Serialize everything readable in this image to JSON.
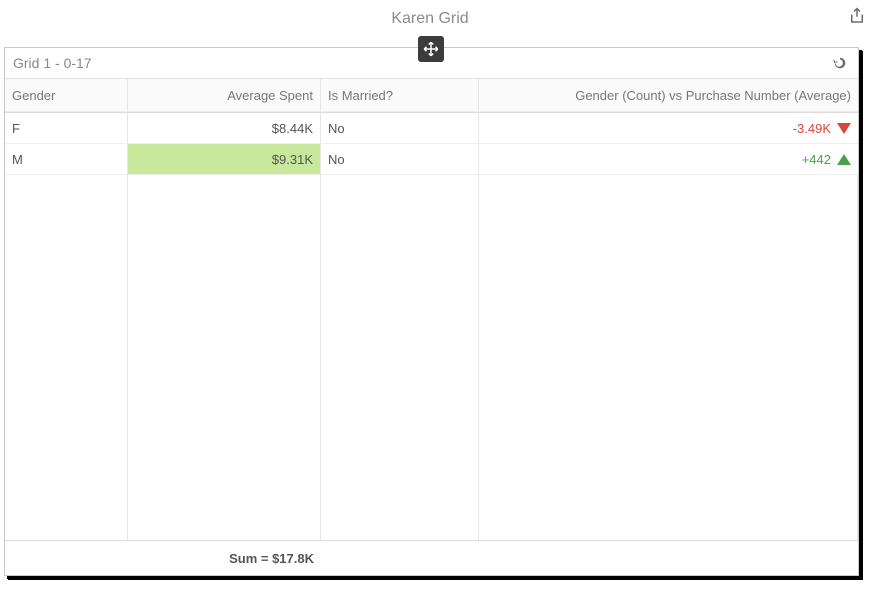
{
  "page": {
    "title": "Karen Grid"
  },
  "panel": {
    "title": "Grid 1 - 0-17"
  },
  "columns": {
    "c0": "Gender",
    "c1": "Average Spent",
    "c2": "Is Married?",
    "c3": "Gender (Count) vs Purchase Number (Average)"
  },
  "rows": [
    {
      "gender": "F",
      "avg_spent": "$8.44K",
      "is_married": "No",
      "delta_text": "-3.49K",
      "direction": "down",
      "highlight_avg": false
    },
    {
      "gender": "M",
      "avg_spent": "$9.31K",
      "is_married": "No",
      "delta_text": "+442",
      "direction": "up",
      "highlight_avg": true
    }
  ],
  "footer": {
    "sum_label": "Sum = $17.8K"
  },
  "chart_data": {
    "type": "table",
    "title": "Karen Grid — Grid 1 - 0-17",
    "columns": [
      "Gender",
      "Average Spent",
      "Is Married?",
      "Gender (Count) vs Purchase Number (Average)"
    ],
    "data": [
      {
        "Gender": "F",
        "Average Spent": 8440,
        "Is Married?": "No",
        "Delta": -3490
      },
      {
        "Gender": "M",
        "Average Spent": 9310,
        "Is Married?": "No",
        "Delta": 442
      }
    ],
    "aggregate": {
      "column": "Average Spent",
      "op": "sum",
      "value": 17800
    }
  }
}
